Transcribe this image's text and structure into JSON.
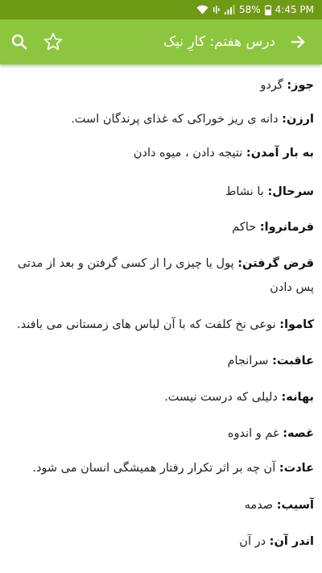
{
  "status_bar": {
    "battery": "58%",
    "time": "4:45 PM"
  },
  "app_bar": {
    "title": "درس هفتم: کارِ نیک"
  },
  "entries": [
    {
      "term": "جوز:",
      "definition": " گردو"
    },
    {
      "term": "ارزن:",
      "definition": " دانه ی ریز خوراکی که غذای پرندگان است."
    },
    {
      "term": "به بار آمدن:",
      "definition": " نتیجه دادن ، میوه دادن"
    },
    {
      "term": "سرحال:",
      "definition": " با نشاط"
    },
    {
      "term": "فرمانروا:",
      "definition": " حاکم"
    },
    {
      "term": "قرض گرفتن:",
      "definition": " پول یا چیزی را از کسی گرفتن و بعد از مدتی پس دادن"
    },
    {
      "term": "کاموا:",
      "definition": " نوعی نخ کلفت که با آن لباس های زمستانی می بافند."
    },
    {
      "term": "عاقبت:",
      "definition": " سرانجام"
    },
    {
      "term": "بهانه:",
      "definition": " دلیلی که درست نیست."
    },
    {
      "term": "غصه:",
      "definition": " غم و اندوه"
    },
    {
      "term": "عادت:",
      "definition": " آن چه بر اثر تکرار رفتار همیشگی انسان می شود."
    },
    {
      "term": "آسیب:",
      "definition": " صدمه"
    },
    {
      "term": "اندر آن:",
      "definition": " در آن"
    }
  ],
  "icons": {
    "back": "arrow-right-icon",
    "star": "star-outline-icon",
    "search": "search-icon"
  },
  "colors": {
    "app_bar": "#8cc63f",
    "status_bar": "#6f9a16",
    "text": "#222222"
  }
}
